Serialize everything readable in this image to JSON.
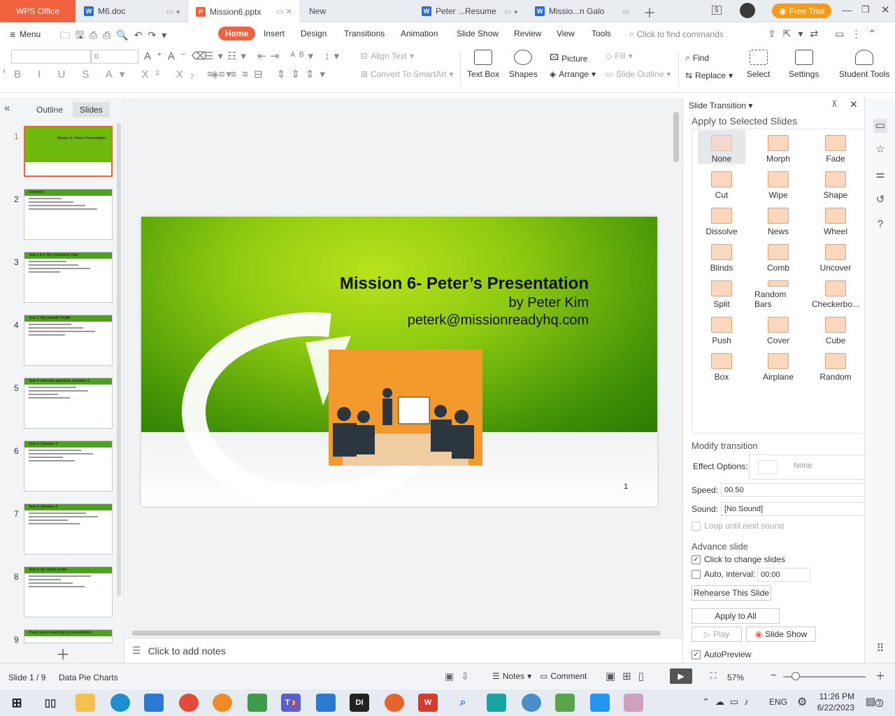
{
  "tabs": {
    "app": "WPS Office",
    "doc1": "M6.doc",
    "active": "Mission6.pptx",
    "new": "New",
    "doc2": "Peter ...Resume",
    "doc3": "Missio...n Galo",
    "page_count": "5",
    "free_trial": "Free Trial"
  },
  "menu": {
    "menu_label": "Menu",
    "items": [
      "Home",
      "Insert",
      "Design",
      "Transitions",
      "Animation",
      "Slide Show",
      "Review",
      "View",
      "Tools"
    ],
    "search_placeholder": "Click to find commands"
  },
  "ribbon": {
    "font_size": "0",
    "align_text": "Align Text",
    "convert_smartart": "Convert To SmartArt",
    "text_box": "Text Box",
    "shapes": "Shapes",
    "picture": "Picture",
    "arrange": "Arrange",
    "fill": "Fill",
    "slide_outline": "Slide Outline",
    "find": "Find",
    "replace": "Replace",
    "select": "Select",
    "settings": "Settings",
    "student_tools": "Student Tools"
  },
  "left_panel": {
    "outline_tab": "Outline",
    "slides_tab": "Slides",
    "thumbs": [
      {
        "num": "1",
        "title": "Mission 6- Peter's Presentation"
      },
      {
        "num": "2",
        "title": "Overview"
      },
      {
        "num": "3",
        "title": "Task 1 & 2: My Curriculum Vitae"
      },
      {
        "num": "4",
        "title": "Task 2: My LinkedIn Profile"
      },
      {
        "num": "5",
        "title": "Task 4: Interview questions, Question 1"
      },
      {
        "num": "6",
        "title": "Task 4, Question 2"
      },
      {
        "num": "7",
        "title": "Task 4, Question 3"
      },
      {
        "num": "8",
        "title": "Task 5: My Github profile"
      },
      {
        "num": "9",
        "title": "Thank you for watching my presentation!"
      }
    ]
  },
  "slide": {
    "title": "Mission 6- Peter’s Presentation",
    "byline": "by Peter Kim",
    "email": "peterk@missionreadyhq.com",
    "number": "1"
  },
  "notes_placeholder": "Click to add notes",
  "transition_panel": {
    "title": "Slide Transition",
    "apply_heading": "Apply to Selected Slides",
    "effects": [
      "None",
      "Morph",
      "Fade",
      "Cut",
      "Wipe",
      "Shape",
      "Dissolve",
      "News",
      "Wheel",
      "Blinds",
      "Comb",
      "Uncover",
      "Split",
      "Random Bars",
      "Checkerbo...",
      "Push",
      "Cover",
      "Cube",
      "Box",
      "Airplane",
      "Random"
    ],
    "modify_heading": "Modify transition",
    "effect_options_label": "Effect Options:",
    "effect_options_value": "None",
    "speed_label": "Speed:",
    "speed_value": "00.50",
    "sound_label": "Sound:",
    "sound_value": "[No Sound]",
    "loop_label": "Loop until next sound",
    "advance_heading": "Advance slide",
    "click_change_label": "Click to change slides",
    "auto_interval_label": "Auto, interval:",
    "auto_interval_value": "00:00",
    "rehearse_label": "Rehearse This Slide",
    "apply_all_label": "Apply to All",
    "play_label": "Play",
    "slideshow_label": "Slide Show",
    "autopreview_label": "AutoPreview"
  },
  "status": {
    "slide_info": "Slide 1 / 9",
    "theme": "Data Pie Charts",
    "notes": "Notes",
    "comment": "Comment",
    "zoom": "57%"
  },
  "taskbar": {
    "lang": "ENG",
    "time": "11:26 PM",
    "date": "6/22/2023",
    "notif_count": "3",
    "teams_badge": "3"
  },
  "colors": {
    "accent": "#f0613e",
    "slide_green": "#6fb80e",
    "slide_orange": "#f39a2d",
    "select_border": "#f0613e"
  }
}
